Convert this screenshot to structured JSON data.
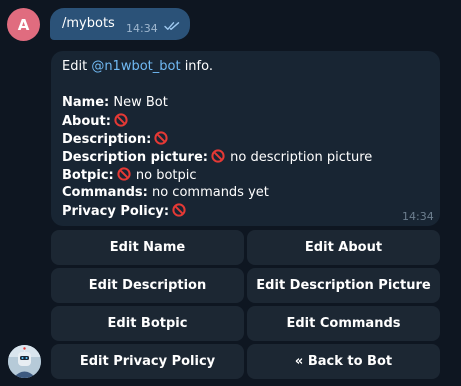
{
  "user": {
    "avatar_letter": "A",
    "avatar_color": "#e06c7f"
  },
  "outgoing": {
    "text": "/mybots",
    "time": "14:34",
    "status": "read-double-check"
  },
  "bot_message": {
    "intro_prefix": "Edit ",
    "mention": "@n1wbot_bot",
    "intro_suffix": " info.",
    "fields": [
      {
        "label": "Name:",
        "value": " New Bot",
        "icon": null
      },
      {
        "label": "About:",
        "value": "",
        "icon": "no-entry-icon"
      },
      {
        "label": "Description:",
        "value": "",
        "icon": "no-entry-icon"
      },
      {
        "label": "Description picture:",
        "value": " no description picture",
        "icon": "no-entry-icon"
      },
      {
        "label": "Botpic:",
        "value": " no botpic",
        "icon": "no-entry-icon"
      },
      {
        "label": "Commands:",
        "value": " no commands yet",
        "icon": null
      },
      {
        "label": "Privacy Policy:",
        "value": "",
        "icon": "no-entry-icon"
      }
    ],
    "time": "14:34"
  },
  "keyboard": {
    "edit_name": "Edit Name",
    "edit_about": "Edit About",
    "edit_description": "Edit Description",
    "edit_description_picture": "Edit Description Picture",
    "edit_botpic": "Edit Botpic",
    "edit_commands": "Edit Commands",
    "edit_privacy_policy": "Edit Privacy Policy",
    "back_to_bot": "« Back to Bot"
  },
  "colors": {
    "background": "#0e1621",
    "outgoing_bubble": "#2b5278",
    "incoming_bubble": "#182533",
    "mention": "#71baf4",
    "no_entry": "#e53935"
  }
}
